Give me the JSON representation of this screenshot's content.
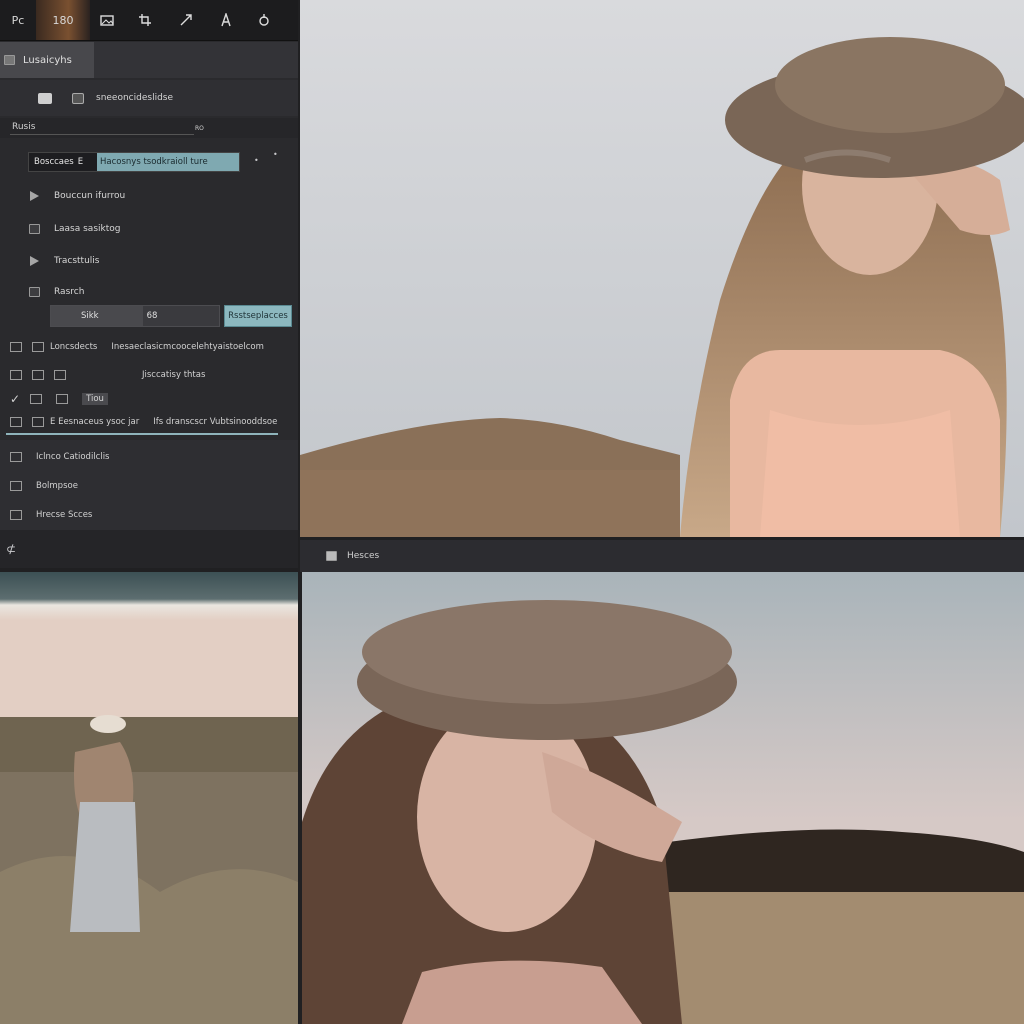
{
  "toolbar": {
    "items": [
      "Pc",
      "180",
      "",
      "",
      "",
      "",
      ""
    ]
  },
  "tabs": {
    "active_label": "Lusaicyhs"
  },
  "panel_row2": {
    "label": "sneeoncideslidse"
  },
  "section": {
    "title": "Rusis",
    "aside": "RO"
  },
  "search": {
    "prefix": "Bosccaes",
    "tag": "E",
    "value": "Hacosnys tsodkraioll ture"
  },
  "rows": [
    {
      "label": "Bouccun ifurrou",
      "icon": "triangle-icon"
    },
    {
      "label": "Laasa sasiktog",
      "icon": "square-icon"
    },
    {
      "label": "Tracsttulis",
      "icon": "triangle-icon"
    },
    {
      "label": "Rasrch",
      "icon": "square-icon"
    }
  ],
  "slider": {
    "min_label": "Sikk",
    "value_label": "68",
    "button_label": "Rsstseplacces",
    "fraction": 0.55
  },
  "options": [
    {
      "a": "Loncsdects",
      "b": "Inesaeclasicmcoocelehtyaistoelcom"
    },
    {
      "a": "",
      "b": "Jisccatisy thtas"
    },
    {
      "a": "",
      "b": "Tiou"
    },
    {
      "a": "E Eesnaceus  ysoc jar",
      "b": "Ifs dranscscr  Vubtsinooddsoe"
    }
  ],
  "layers": [
    {
      "label": "Iclnco Catiodilclis"
    },
    {
      "label": "Bolmpsoe"
    },
    {
      "label": "Hrecse Scces"
    }
  ],
  "footer": {
    "label": "⊄"
  },
  "image_header": {
    "label": "Hesces"
  },
  "colors": {
    "accent": "#8cb8bf",
    "panel": "#2a2a2d",
    "toolbar": "#1c1c1e"
  }
}
